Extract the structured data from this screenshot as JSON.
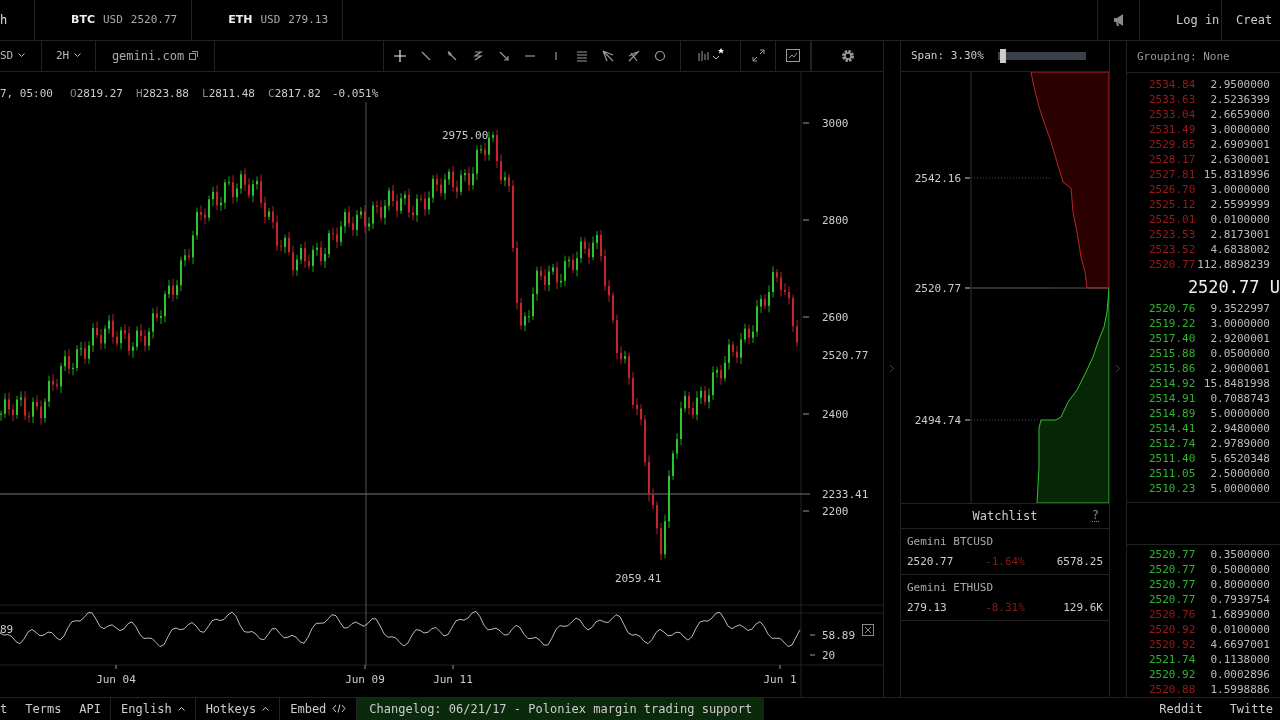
{
  "top_bar": {
    "cut_tab": "h",
    "tickers": [
      {
        "symbol": "BTC",
        "currency": "USD",
        "price": "2520.77"
      },
      {
        "symbol": "ETH",
        "currency": "USD",
        "price": "279.13"
      }
    ],
    "login": "Log in",
    "signup": "Creat"
  },
  "toolbar": {
    "pair": "SD",
    "interval": "2H",
    "source": "gemini.com"
  },
  "ohlc": {
    "date": "7, 05:00",
    "values": [
      {
        "label": "O",
        "value": "2819.27"
      },
      {
        "label": "H",
        "value": "2823.88"
      },
      {
        "label": "L",
        "value": "2811.48"
      },
      {
        "label": "C",
        "value": "2817.82"
      }
    ],
    "change": "-0.051%"
  },
  "price_axis": {
    "ticks": [
      "3000",
      "2800",
      "2600",
      "2400",
      "2200"
    ],
    "last_price": "2520.77",
    "crosshair_price": "2233.41"
  },
  "annotations": {
    "high": "2975.00",
    "low": "2059.41"
  },
  "oscillator": {
    "left_value": "89",
    "value": "58.89",
    "level_label": "20"
  },
  "time_axis": [
    "Jun 04",
    "Jun 09",
    "Jun 11",
    "Jun 1"
  ],
  "depth": {
    "span": "Span: 3.30%",
    "level": 0.02,
    "prices": [
      "2542.16",
      "2520.77",
      "2494.74"
    ]
  },
  "watchlist": {
    "title": "Watchlist",
    "help": "?",
    "items": [
      {
        "name": "Gemini BTCUSD",
        "price": "2520.77",
        "change": "-1.64%",
        "negative": true,
        "volume": "6578.25"
      },
      {
        "name": "Gemini ETHUSD",
        "price": "279.13",
        "change": "-8.31%",
        "negative": true,
        "volume": "129.6K"
      }
    ]
  },
  "order_book": {
    "grouping": "Grouping: None",
    "asks": [
      {
        "price": "2534.84",
        "amount": "2.9500000"
      },
      {
        "price": "2533.63",
        "amount": "2.5236399"
      },
      {
        "price": "2533.04",
        "amount": "2.6659000"
      },
      {
        "price": "2531.49",
        "amount": "3.0000000"
      },
      {
        "price": "2529.85",
        "amount": "2.6909001"
      },
      {
        "price": "2528.17",
        "amount": "2.6300001"
      },
      {
        "price": "2527.81",
        "amount": "15.8318996"
      },
      {
        "price": "2526.70",
        "amount": "3.0000000"
      },
      {
        "price": "2525.12",
        "amount": "2.5599999"
      },
      {
        "price": "2525.01",
        "amount": "0.0100000"
      },
      {
        "price": "2523.53",
        "amount": "2.8173001"
      },
      {
        "price": "2523.52",
        "amount": "4.6838002"
      },
      {
        "price": "2520.77",
        "amount": "112.8898239"
      }
    ],
    "mid": "2520.77 U",
    "bids": [
      {
        "price": "2520.76",
        "amount": "9.3522997"
      },
      {
        "price": "2519.22",
        "amount": "3.0000000"
      },
      {
        "price": "2517.40",
        "amount": "2.9200001"
      },
      {
        "price": "2515.88",
        "amount": "0.0500000"
      },
      {
        "price": "2515.86",
        "amount": "2.9000001"
      },
      {
        "price": "2514.92",
        "amount": "15.8481998"
      },
      {
        "price": "2514.91",
        "amount": "0.7088743"
      },
      {
        "price": "2514.89",
        "amount": "5.0000000"
      },
      {
        "price": "2514.41",
        "amount": "2.9480000"
      },
      {
        "price": "2512.74",
        "amount": "2.9789000"
      },
      {
        "price": "2511.40",
        "amount": "5.6520348"
      },
      {
        "price": "2511.05",
        "amount": "2.5000000"
      },
      {
        "price": "2510.23",
        "amount": "5.0000000"
      }
    ]
  },
  "trades": [
    {
      "price": "2520.77",
      "amount": "0.3500000",
      "sell": false
    },
    {
      "price": "2520.77",
      "amount": "0.5000000",
      "sell": false
    },
    {
      "price": "2520.77",
      "amount": "0.8000000",
      "sell": false
    },
    {
      "price": "2520.77",
      "amount": "0.7939754",
      "sell": false
    },
    {
      "price": "2520.76",
      "amount": "1.6899000",
      "sell": true
    },
    {
      "price": "2520.92",
      "amount": "0.0100000",
      "sell": true
    },
    {
      "price": "2520.92",
      "amount": "4.6697001",
      "sell": true
    },
    {
      "price": "2521.74",
      "amount": "0.1138000",
      "sell": false
    },
    {
      "price": "2520.92",
      "amount": "0.0002896",
      "sell": false
    },
    {
      "price": "2520.88",
      "amount": "1.5998886",
      "sell": true
    }
  ],
  "footer": {
    "left": [
      {
        "label": "t",
        "kind": "link"
      },
      {
        "label": "Terms",
        "kind": "link"
      },
      {
        "label": "API",
        "kind": "link"
      },
      {
        "label": "English",
        "kind": "menu"
      },
      {
        "label": "Hotkeys",
        "kind": "menu"
      },
      {
        "label": "Embed",
        "kind": "embed"
      }
    ],
    "changelog": "Changelog: 06/21/17 - Poloniex margin trading support",
    "right": [
      "Reddit",
      "Twitte"
    ]
  }
}
